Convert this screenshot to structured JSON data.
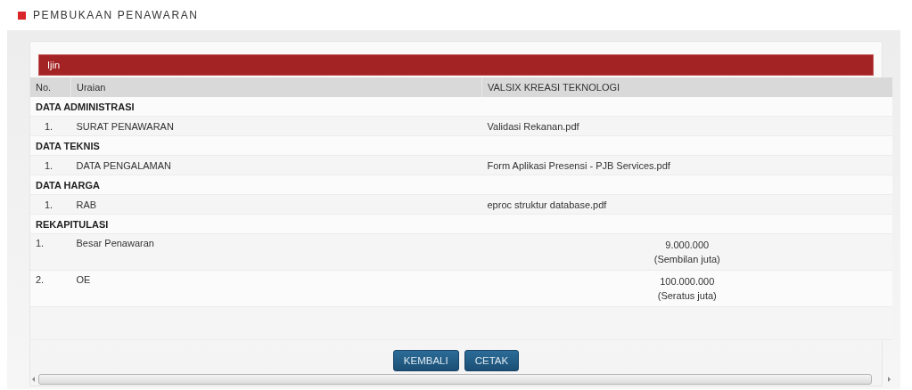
{
  "page_title": "PEMBUKAAN PENAWARAN",
  "section_bar": "Ijin",
  "table": {
    "columns": [
      "No.",
      "Uraian",
      "VALSIX KREASI TEKNOLOGI"
    ],
    "rows": [
      {
        "kind": "group",
        "label": "DATA ADMINISTRASI"
      },
      {
        "kind": "item",
        "no": "1.",
        "uraian": "SURAT PENAWARAN",
        "value": "Validasi Rekanan.pdf"
      },
      {
        "kind": "group",
        "label": "DATA TEKNIS"
      },
      {
        "kind": "item",
        "no": "1.",
        "uraian": "DATA PENGALAMAN",
        "value": "Form Aplikasi Presensi - PJB Services.pdf"
      },
      {
        "kind": "group",
        "label": "DATA HARGA"
      },
      {
        "kind": "item",
        "no": "1.",
        "uraian": "RAB",
        "value": "eproc struktur database.pdf"
      },
      {
        "kind": "group",
        "label": "REKAPITULASI"
      },
      {
        "kind": "amount",
        "no": "1.",
        "uraian": "Besar Penawaran",
        "amount": "9.000.000",
        "words": "(Sembilan juta)"
      },
      {
        "kind": "amount",
        "no": "2.",
        "uraian": "OE",
        "amount": "100.000.000",
        "words": "(Seratus juta)"
      },
      {
        "kind": "blank"
      }
    ]
  },
  "buttons": [
    "KEMBALI",
    "CETAK"
  ]
}
